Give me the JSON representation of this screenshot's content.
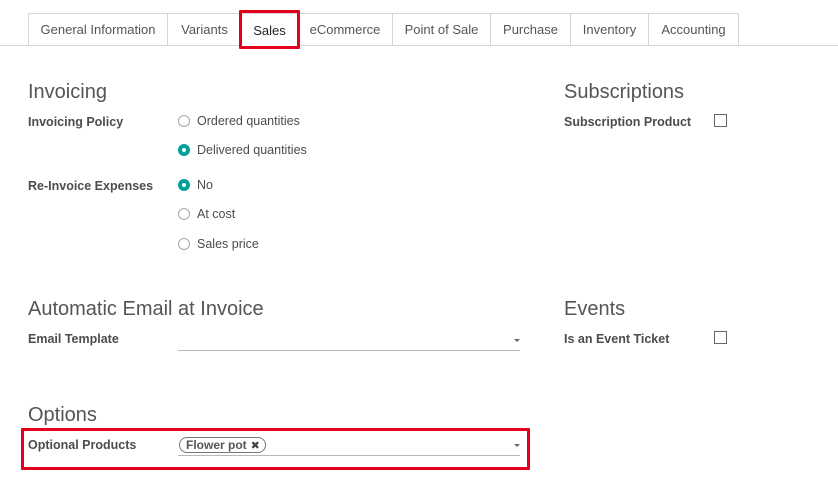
{
  "tabs": [
    {
      "label": "General Information"
    },
    {
      "label": "Variants"
    },
    {
      "label": "Sales"
    },
    {
      "label": "eCommerce"
    },
    {
      "label": "Point of Sale"
    },
    {
      "label": "Purchase"
    },
    {
      "label": "Inventory"
    },
    {
      "label": "Accounting"
    }
  ],
  "invoicing": {
    "title": "Invoicing",
    "policy_label": "Invoicing Policy",
    "policy_options": [
      {
        "label": "Ordered quantities",
        "checked": false
      },
      {
        "label": "Delivered quantities",
        "checked": true
      }
    ],
    "reinvoice_label": "Re-Invoice Expenses",
    "reinvoice_options": [
      {
        "label": "No",
        "checked": true
      },
      {
        "label": "At cost",
        "checked": false
      },
      {
        "label": "Sales price",
        "checked": false
      }
    ]
  },
  "subscriptions": {
    "title": "Subscriptions",
    "product_label": "Subscription Product",
    "product_checked": false
  },
  "email": {
    "title": "Automatic Email at Invoice",
    "template_label": "Email Template",
    "template_value": ""
  },
  "events": {
    "title": "Events",
    "ticket_label": "Is an Event Ticket",
    "ticket_checked": false
  },
  "options": {
    "title": "Options",
    "optional_products_label": "Optional Products",
    "tags": [
      {
        "label": "Flower pot"
      }
    ]
  },
  "colors": {
    "accent": "#00a09d",
    "highlight": "#e3001b"
  }
}
